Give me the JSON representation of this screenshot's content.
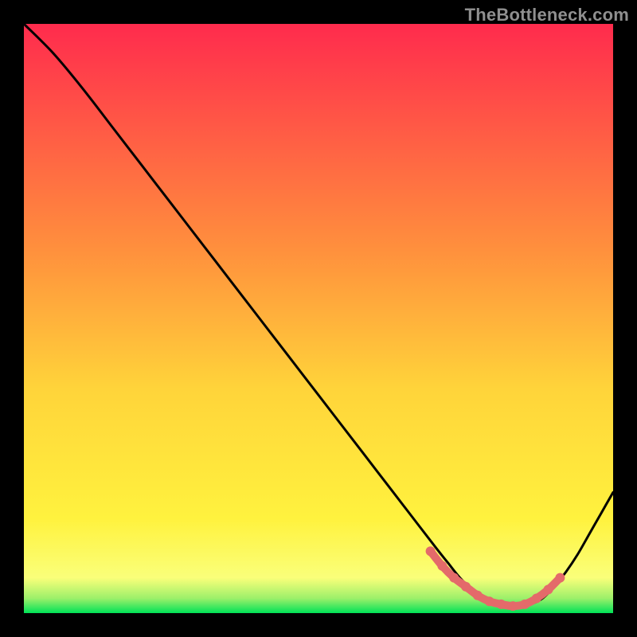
{
  "watermark": "TheBottleneck.com",
  "colors": {
    "top": "#ff2b4d",
    "mid_upper": "#ff8f3d",
    "mid": "#ffd43a",
    "mid_lower": "#fff23e",
    "green": "#00e257",
    "curve": "#000000",
    "dots": "#e46a6a",
    "bg": "#000000"
  },
  "chart_data": {
    "type": "line",
    "title": "",
    "xlabel": "",
    "ylabel": "",
    "xlim": [
      0,
      100
    ],
    "ylim": [
      0,
      100
    ],
    "x": [
      0,
      5,
      10,
      15,
      20,
      25,
      30,
      35,
      40,
      45,
      50,
      55,
      60,
      65,
      70,
      72,
      74,
      76,
      78,
      80,
      82,
      84,
      86,
      88,
      90,
      92,
      94,
      96,
      98,
      100
    ],
    "y": [
      100,
      95,
      89,
      82.5,
      76,
      69.5,
      63,
      56.5,
      50,
      43.5,
      37,
      30.5,
      24,
      17.5,
      11,
      8.5,
      6,
      4,
      2.5,
      1.5,
      1,
      1,
      1.5,
      2.5,
      4.5,
      7,
      10,
      13.5,
      17,
      20.5
    ],
    "valley_marker_x": [
      69,
      71,
      73,
      75,
      77,
      79,
      81,
      83,
      85,
      87,
      89,
      91
    ],
    "valley_marker_y": [
      10.5,
      8,
      6,
      4.5,
      3,
      2,
      1.5,
      1.2,
      1.5,
      2.5,
      4,
      6
    ]
  }
}
